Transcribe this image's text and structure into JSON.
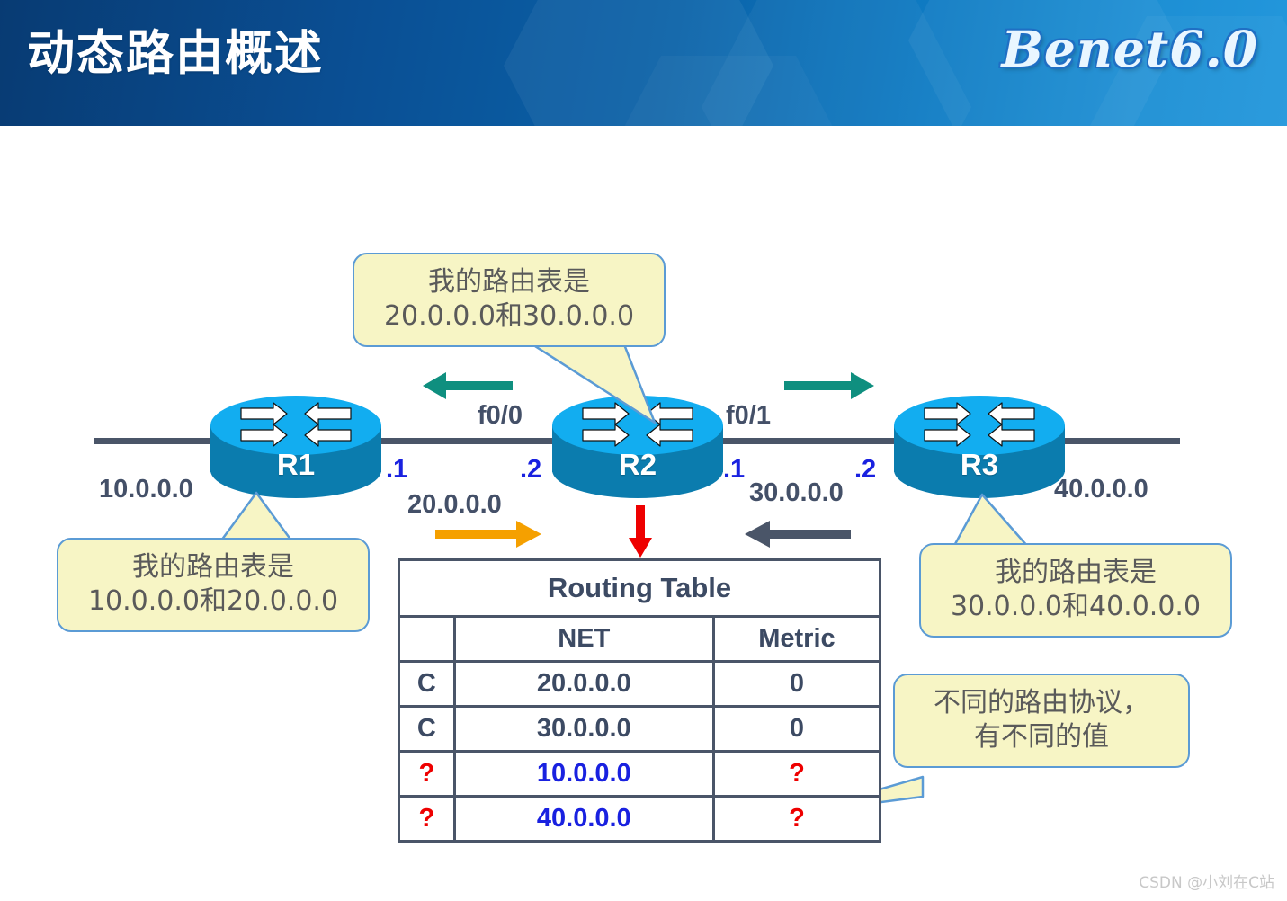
{
  "header": {
    "title": "动态路由概述",
    "logo": "Benet6.0",
    "bg_dark": "#083b73",
    "bg_light": "#2397dc"
  },
  "diagram": {
    "routers": [
      {
        "name": "R1"
      },
      {
        "name": "R2"
      },
      {
        "name": "R3"
      }
    ],
    "networks": [
      {
        "label": "10.0.0.0"
      },
      {
        "label": "20.0.0.0"
      },
      {
        "label": "30.0.0.0"
      },
      {
        "label": "40.0.0.0"
      }
    ],
    "ip_labels": [
      {
        "label": ".1"
      },
      {
        "label": ".2"
      },
      {
        "label": ".1"
      },
      {
        "label": ".2"
      }
    ],
    "interfaces": [
      {
        "label": "f0/0"
      },
      {
        "label": "f0/1"
      }
    ],
    "arrow_colors": {
      "teal": "#0f8f7f",
      "orange": "#f5a000",
      "slate": "#4a5568",
      "red": "#ee0000"
    }
  },
  "callouts": {
    "r1": {
      "line1": "我的路由表是",
      "line2": "10.0.0.0和20.0.0.0"
    },
    "r2": {
      "line1": "我的路由表是",
      "line2": "20.0.0.0和30.0.0.0"
    },
    "r3": {
      "line1": "我的路由表是",
      "line2": "30.0.0.0和40.0.0.0"
    },
    "metric": {
      "line1": "不同的路由协议，",
      "line2": "有不同的值"
    }
  },
  "routing_table": {
    "title": "Routing Table",
    "headers": [
      "",
      "NET",
      "Metric"
    ],
    "rows": [
      {
        "code": "C",
        "net": "20.0.0.0",
        "metric": "0",
        "code_unknown": false,
        "net_new": false
      },
      {
        "code": "C",
        "net": "30.0.0.0",
        "metric": "0",
        "code_unknown": false,
        "net_new": false
      },
      {
        "code": "?",
        "net": "10.0.0.0",
        "metric": "?",
        "code_unknown": true,
        "net_new": true
      },
      {
        "code": "?",
        "net": "40.0.0.0",
        "metric": "?",
        "code_unknown": true,
        "net_new": true
      }
    ]
  },
  "watermark": "CSDN @小刘在C站"
}
